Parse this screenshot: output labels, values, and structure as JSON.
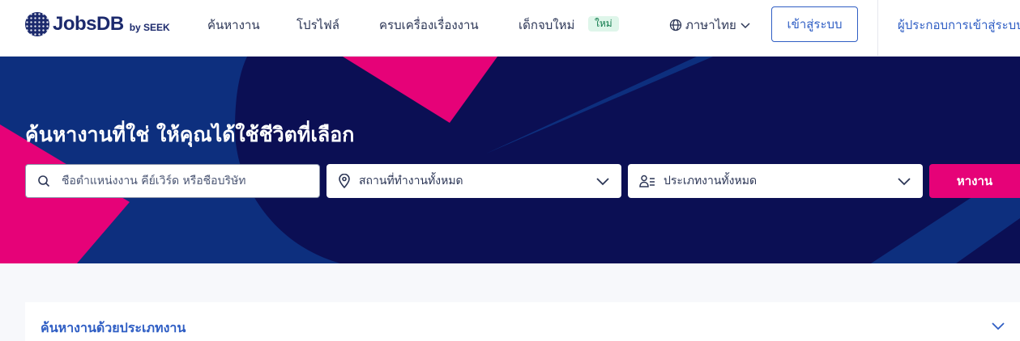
{
  "brand": {
    "name": "JobsDB",
    "byline": "by SEEK",
    "primary_color": "#1c2a6d",
    "accent_color": "#e60278",
    "link_color": "#2f5ec4"
  },
  "nav": {
    "items": [
      {
        "label": "ค้นหางาน"
      },
      {
        "label": "โปรไฟล์"
      },
      {
        "label": "ครบเครื่องเรื่องงาน"
      },
      {
        "label": "เด็กจบใหม่"
      }
    ],
    "new_badge": "ใหม่",
    "language": "ภาษาไทย",
    "login": "เข้าสู่ระบบ",
    "employer_login": "ผู้ประกอบการเข้าสู่ระบบ"
  },
  "hero": {
    "title": "ค้นหางานที่ใช่ ให้คุณได้ใช้ชีวิตที่เลือก",
    "keyword_placeholder": "ชื่อตำแหน่งงาน คีย์เวิร์ด หรือชื่อบริษัท",
    "location_selected": "สถานที่ทำงานทั้งหมด",
    "category_selected": "ประเภทงานทั้งหมด",
    "search_button": "หางาน",
    "background_color": "#0d2f7e",
    "shape_dark_color": "#0b0f54",
    "shape_pink_color": "#e60278"
  },
  "classification": {
    "title": "ค้นหางานด้วยประเภทงาน"
  },
  "icons": {
    "logo": "jobsdb-logo-icon",
    "globe": "globe-icon",
    "search": "search-icon",
    "location": "location-pin-icon",
    "category": "person-list-icon",
    "dropdown": "chevron-down-icon"
  }
}
